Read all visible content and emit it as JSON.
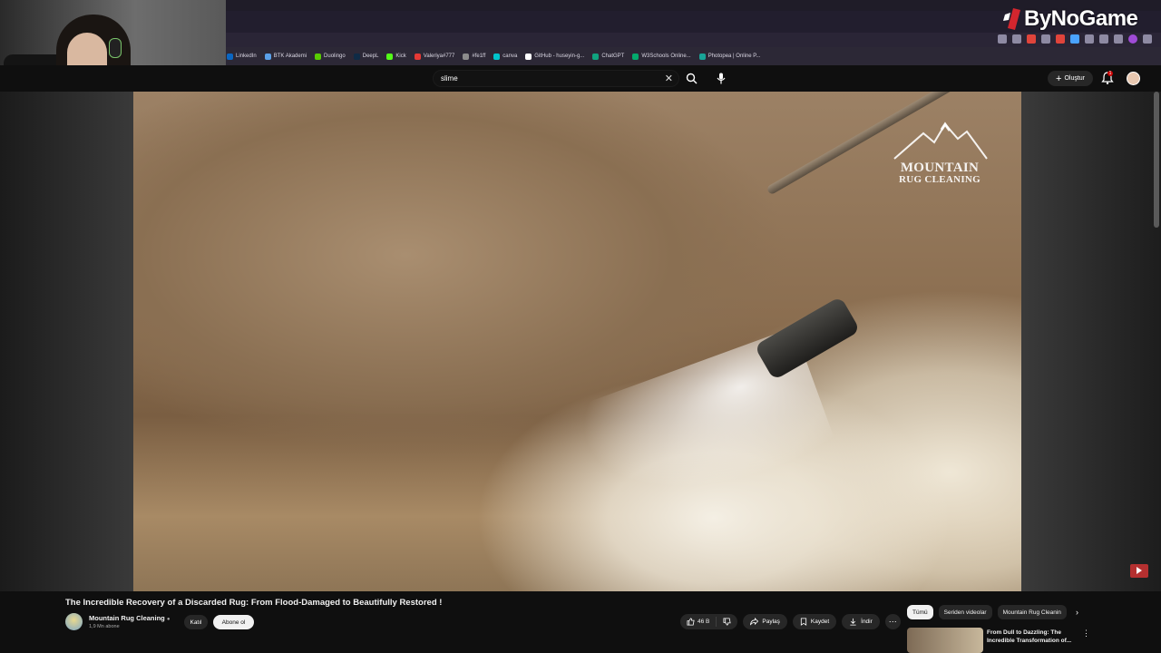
{
  "browser": {
    "bookmarks": [
      "LinkedIn",
      "BTK Akademi",
      "Duolingo",
      "DeepL",
      "Kick",
      "Valeriya#777",
      "#fe1ff",
      "canva",
      "GitHub - huseyin-g...",
      "ChatGPT",
      "W3Schools Online...",
      "Photopea | Online P..."
    ],
    "bookmark_colors": [
      "#0a66c2",
      "#5aa0e8",
      "#58cc02",
      "#0f2b46",
      "#53fc18",
      "#e53935",
      "#8c8c8c",
      "#00c4cc",
      "#ffffff",
      "#10a37f",
      "#04aa6d",
      "#18a497"
    ]
  },
  "brand_overlay": {
    "text": "ByNoGame",
    "accent": "#d3262e"
  },
  "youtube": {
    "search": {
      "query": "slime"
    },
    "create_label": "Oluştur",
    "notification_count": "1"
  },
  "video": {
    "watermark_line1": "MOUNTAIN",
    "watermark_line2": "RUG CLEANING",
    "title": "The Incredible Recovery of a Discarded Rug: From Flood-Damaged to Beautifully Restored !",
    "channel": "Mountain Rug Cleaning",
    "subscribers": "1,9 Mn abone",
    "join_label": "Katıl",
    "subscribe_label": "Abone ol",
    "likes": "46 B",
    "share_label": "Paylaş",
    "save_label": "Kaydet",
    "download_label": "İndir"
  },
  "sidebar": {
    "chips": [
      "Tümü",
      "Seriden videolar",
      "Mountain Rug Cleanin"
    ],
    "recommendation_title": "From Dull to Dazzling: The Incredible Transformation of..."
  }
}
